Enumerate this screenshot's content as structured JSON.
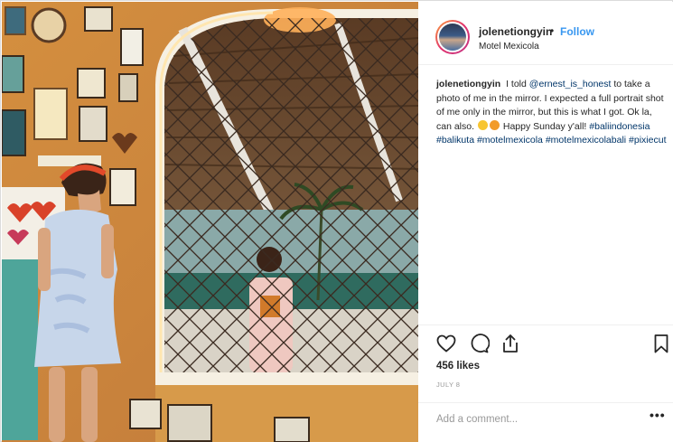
{
  "post": {
    "username": "jolenetiongyin",
    "separator": "•",
    "follow_label": "Follow",
    "location": "Motel Mexicola",
    "caption": {
      "username": "jolenetiongyin",
      "text_1": "I told",
      "mention": "@ernest_is_honest",
      "text_2": "to take a photo of me in the mirror. I expected a full portrait shot of me only in the mirror, but this is what I got. Ok la, can also.",
      "text_3": "Happy Sunday y'all!",
      "hashtags": [
        "#baliindonesia",
        "#balikuta",
        "#motelmexicola",
        "#motelmexicolabali",
        "#pixiecut"
      ]
    },
    "likes": "456 likes",
    "date": "JULY 8",
    "comment_placeholder": "Add a comment...",
    "more_label": "•••"
  },
  "icons": {
    "like": "heart-icon",
    "comment": "comment-bubble-icon",
    "share": "share-icon",
    "save": "bookmark-icon"
  },
  "colors": {
    "link": "#003569",
    "follow": "#3897f0",
    "muted": "#999999",
    "border": "#efefef"
  }
}
